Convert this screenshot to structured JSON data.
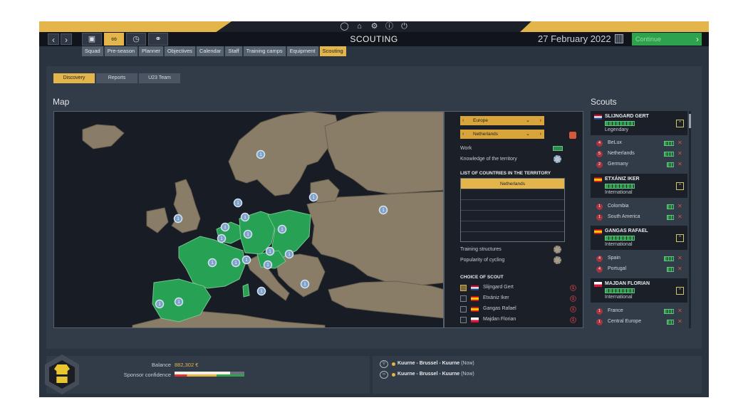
{
  "colors": {
    "accent": "#e4b54a",
    "territory_green": "#27a153",
    "land": "#8a7d68",
    "sea": "#171c25"
  },
  "system_icons": [
    "bell-icon",
    "home-icon",
    "gear-icon",
    "info-icon",
    "power-icon"
  ],
  "header": {
    "title": "SCOUTING",
    "date": "27 February 2022",
    "continue_label": "Continue",
    "mode_icons": [
      "briefcase-icon",
      "cycling-icon",
      "stopwatch-icon",
      "globe-icon"
    ]
  },
  "menu": [
    "Squad",
    "Pre-season",
    "Planner",
    "Objectives",
    "Calendar",
    "Staff",
    "Training camps",
    "Equipment",
    "Scouting"
  ],
  "menu_active": "Scouting",
  "subtabs": [
    "Discovery",
    "Reports",
    "U23 Team"
  ],
  "headings": {
    "map": "Map",
    "scouts": "Scouts"
  },
  "map_markers": [
    "1",
    "1",
    "1",
    "1",
    "1",
    "1",
    "1",
    "1",
    "1",
    "1",
    "1",
    "1",
    "1",
    "1",
    "1",
    "1",
    "1",
    "1",
    "1",
    "1"
  ],
  "territory": {
    "region": "Europe",
    "country": "Netherlands",
    "work_label": "Work",
    "knowledge_label": "Knowledge of the territory",
    "list_heading": "LIST OF COUNTRIES IN THE TERRITORY",
    "countries": [
      "Netherlands",
      "",
      "",
      "",
      "",
      ""
    ],
    "training_label": "Training structures",
    "popularity_label": "Popularity of cycling",
    "choice_heading": "CHOICE OF SCOUT",
    "choices": [
      {
        "name": "Slijngard Gert",
        "checked": true,
        "badge": "1"
      },
      {
        "name": "Etxániz Iker",
        "checked": false,
        "badge": "1"
      },
      {
        "name": "Gangas Rafael",
        "checked": false,
        "badge": "1"
      },
      {
        "name": "Majdan Florian",
        "checked": false,
        "badge": "1"
      }
    ]
  },
  "scouts": [
    {
      "name": "SLIJNGARD GERT",
      "rank": "Legendary",
      "areas": [
        {
          "num": "4",
          "name": "BeLux"
        },
        {
          "num": "5",
          "name": "Netherlands"
        },
        {
          "num": "2",
          "name": "Germany"
        }
      ]
    },
    {
      "name": "ETXÁNIZ IKER",
      "rank": "International",
      "areas": [
        {
          "num": "1",
          "name": "Colombia"
        },
        {
          "num": "1",
          "name": "South America"
        }
      ]
    },
    {
      "name": "GANGAS RAFAEL",
      "rank": "International",
      "areas": [
        {
          "num": "4",
          "name": "Spain"
        },
        {
          "num": "4",
          "name": "Portugal"
        }
      ]
    },
    {
      "name": "MAJDAN FLORIAN",
      "rank": "International",
      "areas": [
        {
          "num": "1",
          "name": "France"
        },
        {
          "num": "1",
          "name": "Central Europe"
        }
      ]
    }
  ],
  "finance": {
    "balance_label": "Balance",
    "balance_value": "882,302 €",
    "sponsor_label": "Sponsor confidence",
    "sponsor_confidence": 0.8
  },
  "races": [
    {
      "icon": "trophy-icon",
      "name": "Kuurne - Brussel - Kuurne",
      "when": "(Now)"
    },
    {
      "icon": "binoculars-icon",
      "name": "Kuurne - Brussel - Kuurne",
      "when": "(Now)"
    }
  ]
}
